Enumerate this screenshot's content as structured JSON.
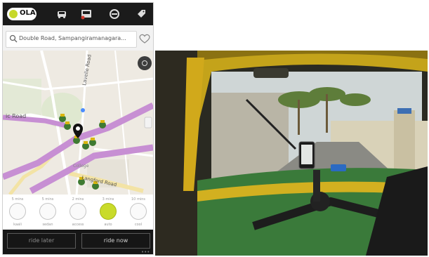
{
  "app": {
    "logo_text": "OLA",
    "nav_icons": [
      "car-icon",
      "bus-icon",
      "helmet-icon",
      "tag-icon"
    ]
  },
  "search": {
    "location": "Double Road, Sampangiramanagara..."
  },
  "map": {
    "labels": {
      "road_left": "ic Road",
      "lavelle_road": "Lavelle Road",
      "langford_road": "Langford Road",
      "college": "College"
    }
  },
  "car_options": [
    {
      "time": "5 mins",
      "name": "kaali",
      "icon": "taxi-icon",
      "selected": false
    },
    {
      "time": "5 mins",
      "name": "sedan",
      "icon": "sedan-icon",
      "selected": false
    },
    {
      "time": "2 mins",
      "name": "access",
      "icon": "access-icon",
      "selected": false
    },
    {
      "time": "3 mins",
      "name": "auto",
      "icon": "auto-rickshaw-icon",
      "selected": true
    },
    {
      "time": "10 mins",
      "name": "cool",
      "icon": "cool-cab-icon",
      "selected": false
    }
  ],
  "buttons": {
    "ride_later": "ride later",
    "ride_now": "ride now",
    "more": "•••"
  },
  "colors": {
    "brand_lime": "#c9db2a",
    "topbar": "#1b1b1b",
    "route": "#c78fd3",
    "auto_green": "#3f7a32",
    "auto_yellow": "#d9b60e"
  },
  "photo": {
    "subject": "view from inside an auto-rickshaw with phone mounted on handlebar"
  }
}
